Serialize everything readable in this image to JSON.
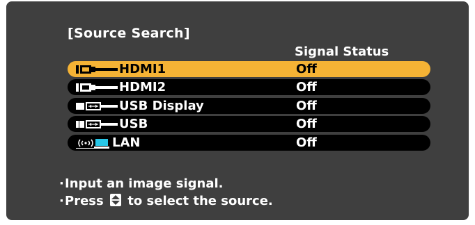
{
  "dialog": {
    "title": "[Source Search]",
    "column_header": "Signal Status",
    "sources": [
      {
        "label": "HDMI1",
        "status": "Off",
        "icon": "hdmi-icon",
        "selected": true
      },
      {
        "label": "HDMI2",
        "status": "Off",
        "icon": "hdmi-icon",
        "selected": false
      },
      {
        "label": "USB Display",
        "status": "Off",
        "icon": "usb-icon",
        "selected": false
      },
      {
        "label": "USB",
        "status": "Off",
        "icon": "usb-icon",
        "selected": false
      },
      {
        "label": "LAN",
        "status": "Off",
        "icon": "lan-icon",
        "selected": false
      }
    ],
    "hints": {
      "line1": "Input an image signal.",
      "line2_prefix": "Press",
      "line2_suffix": "to select the source."
    }
  },
  "colors": {
    "background": "#3f3f3f",
    "selected_row": "#f5b335",
    "row": "#000000",
    "text": "#ffffff",
    "lan_screen": "#27c7e8"
  }
}
